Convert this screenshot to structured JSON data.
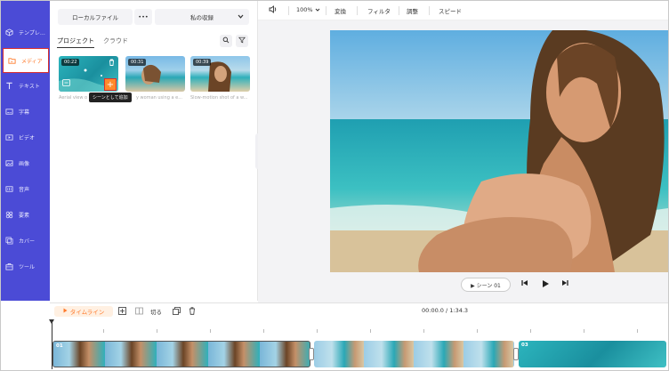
{
  "sidebar": {
    "items": [
      {
        "label": "テンプレ…",
        "icon": "cube-icon"
      },
      {
        "label": "メディア",
        "icon": "folder-icon",
        "active": true
      },
      {
        "label": "テキスト",
        "icon": "text-icon"
      },
      {
        "label": "字幕",
        "icon": "subtitle-icon"
      },
      {
        "label": "ビデオ",
        "icon": "video-icon"
      },
      {
        "label": "画像",
        "icon": "image-icon"
      },
      {
        "label": "音声",
        "icon": "audio-icon"
      },
      {
        "label": "要素",
        "icon": "elements-icon"
      },
      {
        "label": "カバー",
        "icon": "cover-icon"
      },
      {
        "label": "ツール",
        "icon": "toolbox-icon"
      }
    ]
  },
  "media": {
    "local_file_label": "ローカルファイル",
    "more_label": "•••",
    "favorites_label": "私の収録",
    "tabs": [
      {
        "label": "プロジェクト",
        "active": true
      },
      {
        "label": "クラウド",
        "active": false
      }
    ],
    "thumbs": [
      {
        "duration": "00:22",
        "caption": "Aerial view o"
      },
      {
        "duration": "00:31",
        "caption": "y woman using a e..."
      },
      {
        "duration": "00:39",
        "caption": "Slow-motion shot of a w..."
      }
    ],
    "tooltip": "シーンとして追加",
    "add_symbol": "+"
  },
  "toolbar": {
    "zoom": "100%",
    "items": [
      "変換",
      "フィルタ",
      "調整",
      "スピード"
    ]
  },
  "preview": {
    "scene_label": "▶ シーン 01"
  },
  "timeline": {
    "label": "タイムライン",
    "cut_label": "切る",
    "time": "00:00.0 / 1:34.3",
    "clips": [
      "01",
      "",
      "03"
    ]
  },
  "colors": {
    "sidebar": "#4b4bd6",
    "accent": "#ff7a2b",
    "highlight_border": "#d93030"
  }
}
